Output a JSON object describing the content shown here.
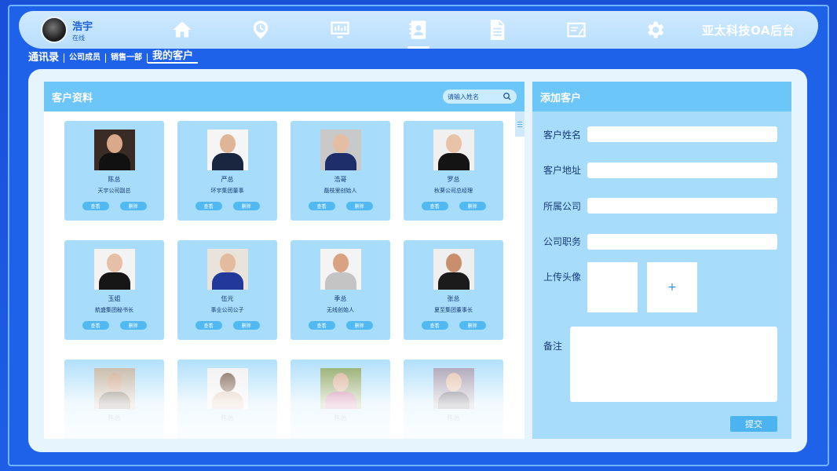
{
  "app": {
    "brand": "亚太科技OA后台"
  },
  "user": {
    "name": "浩宇",
    "role": "在线"
  },
  "nav": [
    {
      "icon": "home-icon",
      "active": false
    },
    {
      "icon": "clock-icon",
      "active": false
    },
    {
      "icon": "chart-icon",
      "active": false
    },
    {
      "icon": "contacts-icon",
      "active": true
    },
    {
      "icon": "document-icon",
      "active": false
    },
    {
      "icon": "edit-icon",
      "active": false
    },
    {
      "icon": "gear-icon",
      "active": false
    }
  ],
  "breadcrumb": [
    "通讯录",
    "公司成员",
    "销售一部",
    "我的客户"
  ],
  "customers": {
    "title": "客户资料",
    "search_placeholder": "请输入姓名",
    "view_label": "查看",
    "delete_label": "删除",
    "items": [
      {
        "name": "陈总",
        "title": "天宇公司副总"
      },
      {
        "name": "严总",
        "title": "环宇集团董事"
      },
      {
        "name": "浩哥",
        "title": "磊枝里创始人"
      },
      {
        "name": "罗总",
        "title": "秋葵公司总经理"
      },
      {
        "name": "玉姐",
        "title": "航盛集团秘书长"
      },
      {
        "name": "伍元",
        "title": "事业公司公子"
      },
      {
        "name": "季总",
        "title": "无线创始人"
      },
      {
        "name": "张总",
        "title": "夏至集团董事长"
      },
      {
        "name": "陈总",
        "title": ""
      },
      {
        "name": "陈总",
        "title": ""
      },
      {
        "name": "陈总",
        "title": ""
      },
      {
        "name": "陈总",
        "title": ""
      }
    ]
  },
  "add_customer": {
    "title": "添加客户",
    "fields": [
      {
        "label": "客户姓名",
        "value": ""
      },
      {
        "label": "客户地址",
        "value": ""
      },
      {
        "label": "所属公司",
        "value": ""
      },
      {
        "label": "公司职务",
        "value": ""
      }
    ],
    "upload_label": "上传头像",
    "upload_plus": "+",
    "remark_label": "备注",
    "submit_label": "提交"
  }
}
